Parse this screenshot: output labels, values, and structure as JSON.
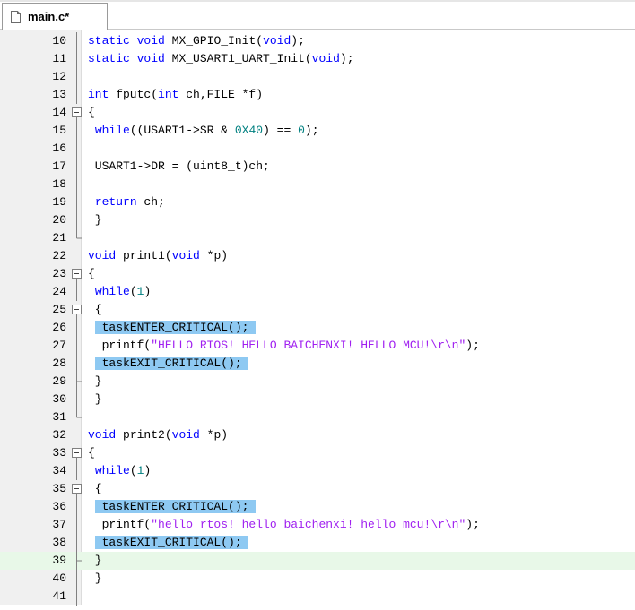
{
  "tab": {
    "label": "main.c*"
  },
  "colors": {
    "keyword": "#0000ff",
    "number": "#008080",
    "string": "#a020f0",
    "selection": "#8ec9f2",
    "current_line": "#e8f8e8",
    "gutter": "#f0f0f0"
  },
  "editor": {
    "lines": [
      {
        "no": "10",
        "fold": "line",
        "tokens": [
          [
            "kw",
            "static"
          ],
          [
            "p",
            " "
          ],
          [
            "kw",
            "void"
          ],
          [
            "p",
            " MX_GPIO_Init("
          ],
          [
            "kw",
            "void"
          ],
          [
            "p",
            ");"
          ]
        ]
      },
      {
        "no": "11",
        "fold": "line",
        "tokens": [
          [
            "kw",
            "static"
          ],
          [
            "p",
            " "
          ],
          [
            "kw",
            "void"
          ],
          [
            "p",
            " MX_USART1_UART_Init("
          ],
          [
            "kw",
            "void"
          ],
          [
            "p",
            ");"
          ]
        ]
      },
      {
        "no": "12",
        "fold": "line",
        "tokens": []
      },
      {
        "no": "13",
        "fold": "line",
        "tokens": [
          [
            "kw",
            "int"
          ],
          [
            "p",
            " fputc("
          ],
          [
            "kw",
            "int"
          ],
          [
            "p",
            " ch,FILE *f)"
          ]
        ]
      },
      {
        "no": "14",
        "fold": "box",
        "tokens": [
          [
            "p",
            "{"
          ]
        ]
      },
      {
        "no": "15",
        "fold": "line",
        "tokens": [
          [
            "p",
            " "
          ],
          [
            "kw",
            "while"
          ],
          [
            "p",
            "((USART1->SR & "
          ],
          [
            "num",
            "0X40"
          ],
          [
            "p",
            ") == "
          ],
          [
            "num",
            "0"
          ],
          [
            "p",
            ");"
          ]
        ]
      },
      {
        "no": "16",
        "fold": "line",
        "tokens": []
      },
      {
        "no": "17",
        "fold": "line",
        "tokens": [
          [
            "p",
            " USART1->DR = (uint8_t)ch;"
          ]
        ]
      },
      {
        "no": "18",
        "fold": "line",
        "tokens": []
      },
      {
        "no": "19",
        "fold": "line",
        "tokens": [
          [
            "p",
            " "
          ],
          [
            "kw",
            "return"
          ],
          [
            "p",
            " ch;"
          ]
        ]
      },
      {
        "no": "20",
        "fold": "line",
        "tokens": [
          [
            "p",
            " }"
          ]
        ]
      },
      {
        "no": "21",
        "fold": "end",
        "tokens": []
      },
      {
        "no": "22",
        "fold": "none",
        "tokens": [
          [
            "kw",
            "void"
          ],
          [
            "p",
            " print1("
          ],
          [
            "kw",
            "void"
          ],
          [
            "p",
            " *p)"
          ]
        ]
      },
      {
        "no": "23",
        "fold": "box",
        "tokens": [
          [
            "p",
            "{"
          ]
        ]
      },
      {
        "no": "24",
        "fold": "line",
        "tokens": [
          [
            "p",
            " "
          ],
          [
            "kw",
            "while"
          ],
          [
            "p",
            "("
          ],
          [
            "num",
            "1"
          ],
          [
            "p",
            ")"
          ]
        ]
      },
      {
        "no": "25",
        "fold": "box",
        "tokens": [
          [
            "p",
            " {"
          ]
        ]
      },
      {
        "no": "26",
        "fold": "line",
        "sel": true,
        "tokens": [
          [
            "p",
            "  taskENTER_CRITICAL();"
          ]
        ]
      },
      {
        "no": "27",
        "fold": "line",
        "tokens": [
          [
            "p",
            "  printf("
          ],
          [
            "str",
            "\"HELLO RTOS! HELLO BAICHENXI! HELLO MCU!\\r\\n\""
          ],
          [
            "p",
            ");"
          ]
        ]
      },
      {
        "no": "28",
        "fold": "line",
        "sel": true,
        "tokens": [
          [
            "p",
            "  taskEXIT_CRITICAL();"
          ]
        ]
      },
      {
        "no": "29",
        "fold": "tee",
        "tokens": [
          [
            "p",
            " }"
          ]
        ]
      },
      {
        "no": "30",
        "fold": "line",
        "tokens": [
          [
            "p",
            " }"
          ]
        ]
      },
      {
        "no": "31",
        "fold": "end",
        "tokens": []
      },
      {
        "no": "32",
        "fold": "none",
        "tokens": [
          [
            "kw",
            "void"
          ],
          [
            "p",
            " print2("
          ],
          [
            "kw",
            "void"
          ],
          [
            "p",
            " *p)"
          ]
        ]
      },
      {
        "no": "33",
        "fold": "box",
        "tokens": [
          [
            "p",
            "{"
          ]
        ]
      },
      {
        "no": "34",
        "fold": "line",
        "tokens": [
          [
            "p",
            " "
          ],
          [
            "kw",
            "while"
          ],
          [
            "p",
            "("
          ],
          [
            "num",
            "1"
          ],
          [
            "p",
            ")"
          ]
        ]
      },
      {
        "no": "35",
        "fold": "box",
        "tokens": [
          [
            "p",
            " {"
          ]
        ]
      },
      {
        "no": "36",
        "fold": "line",
        "sel": true,
        "tokens": [
          [
            "p",
            "  taskENTER_CRITICAL();"
          ]
        ]
      },
      {
        "no": "37",
        "fold": "line",
        "tokens": [
          [
            "p",
            "  printf("
          ],
          [
            "str",
            "\"hello rtos! hello baichenxi! hello mcu!\\r\\n\""
          ],
          [
            "p",
            ");"
          ]
        ]
      },
      {
        "no": "38",
        "fold": "line",
        "sel": true,
        "tokens": [
          [
            "p",
            "  taskEXIT_CRITICAL();"
          ]
        ]
      },
      {
        "no": "39",
        "fold": "tee",
        "current": true,
        "tokens": [
          [
            "p",
            " }"
          ]
        ]
      },
      {
        "no": "40",
        "fold": "line",
        "tokens": [
          [
            "p",
            " }"
          ]
        ]
      },
      {
        "no": "41",
        "fold": "line",
        "tokens": []
      }
    ]
  }
}
